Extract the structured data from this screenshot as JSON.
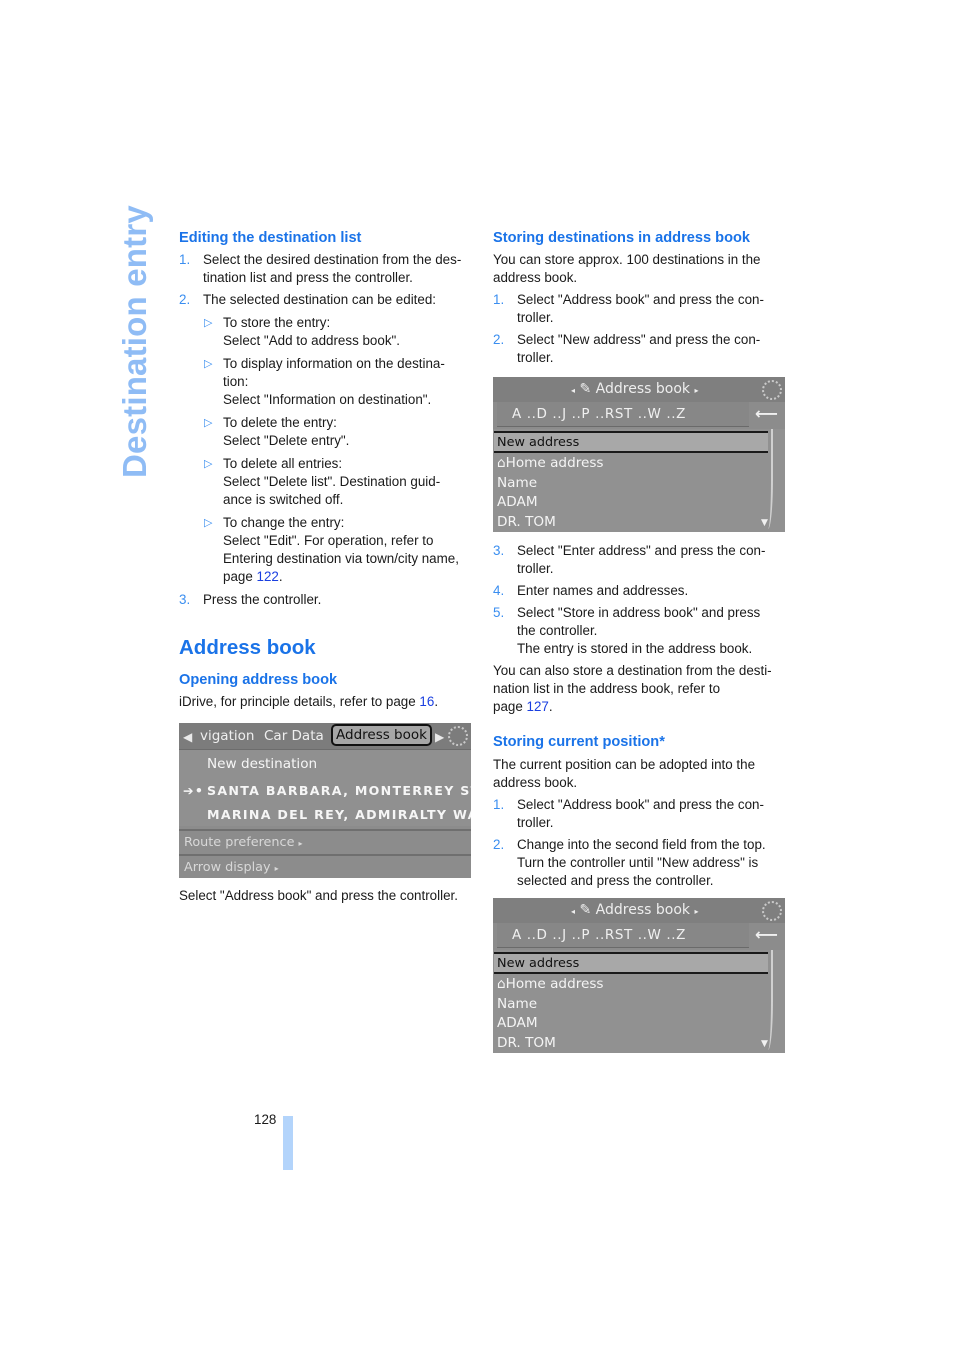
{
  "side_title": "Destination entry",
  "left": {
    "editing": {
      "heading": "Editing the destination list",
      "steps": [
        {
          "n": "1.",
          "lines": [
            "Select the desired destination from the des-",
            "tination list and press the controller."
          ]
        },
        {
          "n": "2.",
          "lines": [
            "The selected destination can be edited:"
          ],
          "sub": [
            {
              "lines": [
                "To store the entry:",
                "Select \"Add to address book\"."
              ]
            },
            {
              "lines": [
                "To display information on the destina-",
                "tion:",
                "Select \"Information on destination\"."
              ]
            },
            {
              "lines": [
                "To delete the entry:",
                "Select \"Delete entry\"."
              ]
            },
            {
              "lines": [
                "To delete all entries:",
                "Select \"Delete list\". Destination guid-",
                "ance is switched off."
              ]
            },
            {
              "lines": [
                "To change the entry:",
                "Select \"Edit\". For operation, refer to",
                "Entering destination via town/city name,"
              ],
              "page_prefix": "page ",
              "page_link": "122",
              "page_suffix": "."
            }
          ]
        },
        {
          "n": "3.",
          "lines": [
            "Press the controller."
          ]
        }
      ]
    },
    "address_book": {
      "heading": "Address book",
      "opening_heading": "Opening address book",
      "opening_text": "iDrive, for principle details, refer to page ",
      "opening_link": "16",
      "opening_suffix": ".",
      "caption": "Select \"Address book\" and press the controller."
    },
    "nav_screen": {
      "tab_prev": "vigation",
      "tab_mid": "Car Data",
      "tab_selected": "Address book",
      "rows": [
        "New destination",
        "SANTA BARBARA, MONTERREY ST",
        "MARINA DEL REY, ADMIRALTY WA"
      ],
      "options": [
        "Route preference",
        "Arrow display"
      ]
    }
  },
  "right": {
    "storing": {
      "heading": "Storing destinations in address book",
      "intro": [
        "You can store approx. 100 destinations in the",
        "address book."
      ],
      "steps_a": [
        {
          "n": "1.",
          "lines": [
            "Select \"Address book\" and press the con-",
            "troller."
          ]
        },
        {
          "n": "2.",
          "lines": [
            "Select \"New address\" and press the con-",
            "troller."
          ]
        }
      ],
      "steps_b": [
        {
          "n": "3.",
          "lines": [
            "Select \"Enter address\" and press the con-",
            "troller."
          ]
        },
        {
          "n": "4.",
          "lines": [
            "Enter names and addresses."
          ]
        },
        {
          "n": "5.",
          "lines": [
            "Select \"Store in address book\" and press",
            "the controller.",
            "The entry is stored in the address book."
          ]
        }
      ],
      "outro": [
        "You can also store a destination from the desti-",
        "nation list in the address book, refer to"
      ],
      "outro_page_prefix": "page ",
      "outro_link": "127",
      "outro_suffix": "."
    },
    "current": {
      "heading": "Storing current position*",
      "intro": [
        "The current position can be adopted into the",
        "address book."
      ],
      "steps": [
        {
          "n": "1.",
          "lines": [
            "Select \"Address book\" and press the con-",
            "troller."
          ]
        },
        {
          "n": "2.",
          "lines": [
            "Change into the second field from the top.",
            "Turn the controller until \"New address\" is",
            "selected and press the controller."
          ]
        }
      ]
    },
    "ab_screen": {
      "title": "Address book",
      "alphabet": "A ..D ..J ..P ..RST ..W ..Z",
      "selected": "New address",
      "items": [
        "Home address",
        "Name",
        "ADAM",
        "DR. TOM"
      ]
    }
  },
  "footer": {
    "page_number": "128"
  }
}
